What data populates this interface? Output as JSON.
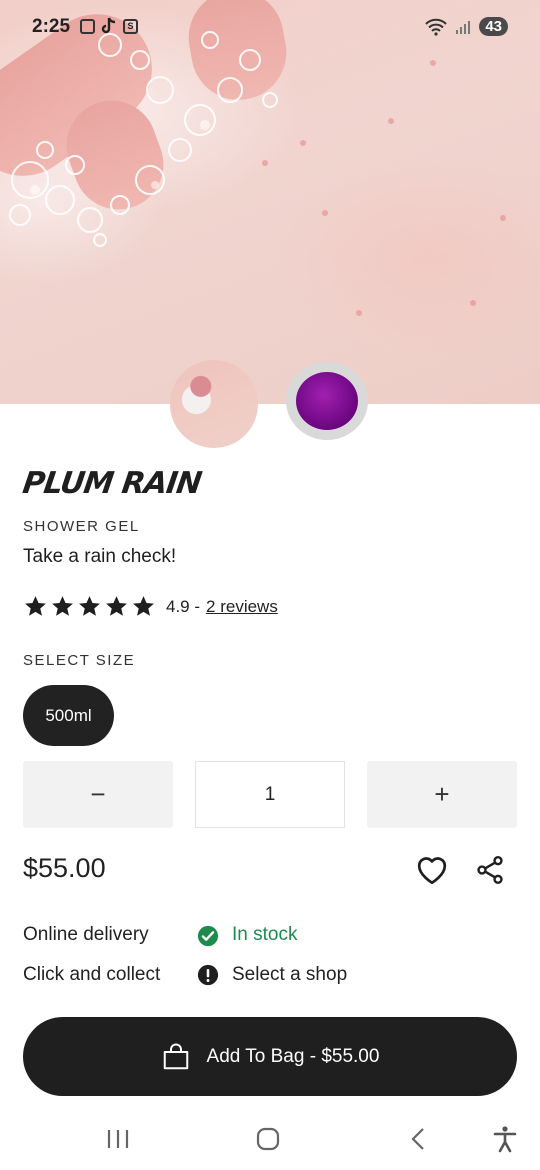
{
  "status_bar": {
    "time": "2:25",
    "battery": "43",
    "icons_left": [
      "screenshot-icon",
      "tiktok-icon",
      "s-app-icon"
    ],
    "icons_right": [
      "wifi-icon",
      "signal-icon",
      "battery-icon"
    ]
  },
  "gallery": {
    "thumbnails": [
      "lifestyle-thumbnail",
      "product-jar-thumbnail"
    ],
    "selected": 1
  },
  "product": {
    "name": "PLUM RAIN",
    "category": "SHOWER GEL",
    "tagline": "Take a rain check!",
    "rating": 4.9,
    "rating_text": "4.9 -",
    "reviews_link": "2 reviews",
    "stars": 5
  },
  "size": {
    "label": "SELECT SIZE",
    "options": [
      "500ml"
    ],
    "selected": "500ml"
  },
  "quantity": {
    "minus": "−",
    "value": "1",
    "plus": "+"
  },
  "price": "$55.00",
  "availability": {
    "online_label": "Online delivery",
    "online_status": "In stock",
    "collect_label": "Click and collect",
    "collect_status": "Select a shop"
  },
  "add_to_bag": "Add To Bag - $55.00",
  "colors": {
    "accent_dark": "#1f1f1f",
    "in_stock_green": "#1e8a4c",
    "product_purple": "#8a12a0"
  },
  "nav_bar": [
    "recents-icon",
    "home-icon",
    "back-icon",
    "accessibility-icon"
  ]
}
